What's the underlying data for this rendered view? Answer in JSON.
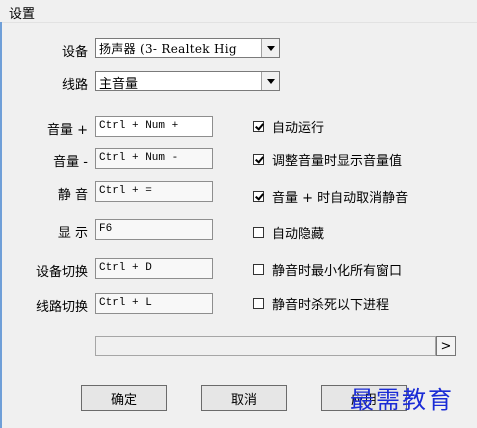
{
  "window": {
    "title": "设置"
  },
  "device": {
    "label": "设备",
    "value": "扬声器 (3- Realtek Hig"
  },
  "line": {
    "label": "线路",
    "value": "主音量"
  },
  "hotkeys": [
    {
      "label": "音量 +",
      "value": "Ctrl + Num +"
    },
    {
      "label": "音量 -",
      "value": "Ctrl + Num -"
    },
    {
      "label": "静 音",
      "value": "Ctrl + ="
    },
    {
      "label": "显 示",
      "value": "F6"
    },
    {
      "label": "设备切换",
      "value": "Ctrl + D"
    },
    {
      "label": "线路切换",
      "value": "Ctrl + L"
    }
  ],
  "options": [
    {
      "label": "自动运行",
      "checked": true
    },
    {
      "label": "调整音量时显示音量值",
      "checked": true
    },
    {
      "label": "音量 + 时自动取消静音",
      "checked": true
    },
    {
      "label": "自动隐藏",
      "checked": false
    },
    {
      "label": "静音时最小化所有窗口",
      "checked": false
    },
    {
      "label": "静音时杀死以下进程",
      "checked": false
    }
  ],
  "process": {
    "more_label": ">",
    "progress": 0
  },
  "buttons": {
    "ok": "确定",
    "cancel": "取消",
    "apply": "应用"
  },
  "watermark": "最需教育",
  "colors": {
    "watermark": "#1a2bd6",
    "window_bg": "#f0f0f0"
  }
}
